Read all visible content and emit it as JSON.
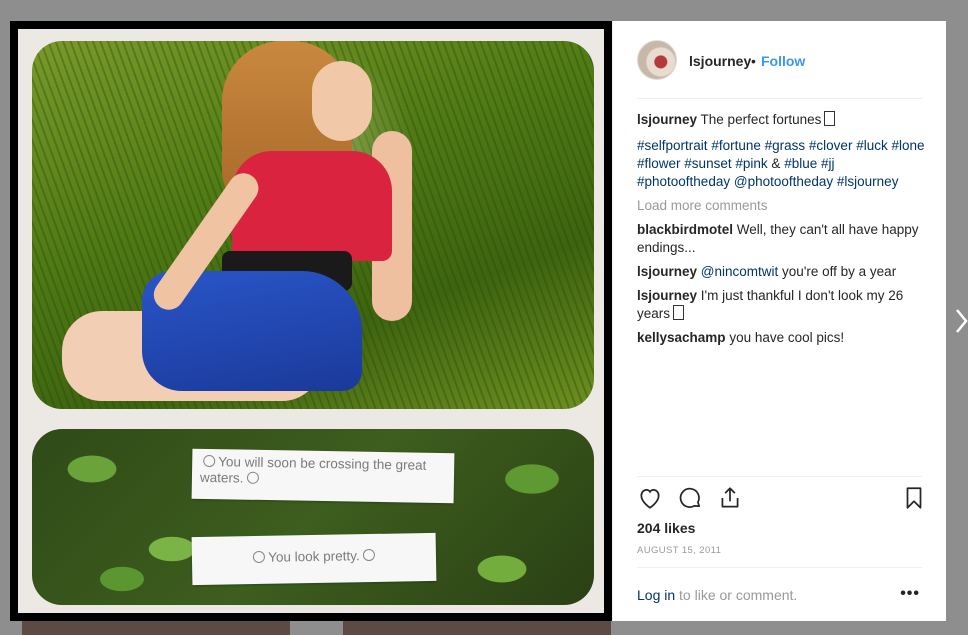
{
  "post": {
    "username": "lsjourney",
    "follow_label": "Follow",
    "separator": "•",
    "caption": {
      "user": "lsjourney",
      "text": "The perfect fortunes"
    },
    "hashtags": [
      "#selfportrait",
      "#fortune",
      "#grass",
      "#clover",
      "#luck",
      "#lone",
      "#flower",
      "#sunset",
      "#pink",
      "&",
      "#blue",
      "#jj",
      "#photooftheday",
      "@photooftheday",
      "#lsjourney"
    ],
    "load_more_label": "Load more comments",
    "comments": [
      {
        "user": "blackbirdmotel",
        "text": "Well, they can't all have happy endings..."
      },
      {
        "user": "lsjourney",
        "mention": "@nincomtwit",
        "text": "you're off by a year"
      },
      {
        "user": "lsjourney",
        "text": "I'm just thankful I don't look my 26 years"
      },
      {
        "user": "kellysachamp",
        "text": "you have cool pics!"
      }
    ],
    "likes": "204 likes",
    "date": "AUGUST 15, 2011",
    "login_link": "Log in",
    "login_suffix": "to like or comment.",
    "more_label": "•••"
  },
  "media": {
    "note_1": "You will soon be crossing the great waters.",
    "note_2": "You look pretty."
  },
  "icons": {
    "like": "heart-icon",
    "comment": "comment-icon",
    "share": "share-icon",
    "save": "bookmark-icon",
    "next": "chevron-right-icon"
  },
  "colors": {
    "link": "#003569",
    "follow": "#3897f0",
    "muted": "#999999"
  }
}
